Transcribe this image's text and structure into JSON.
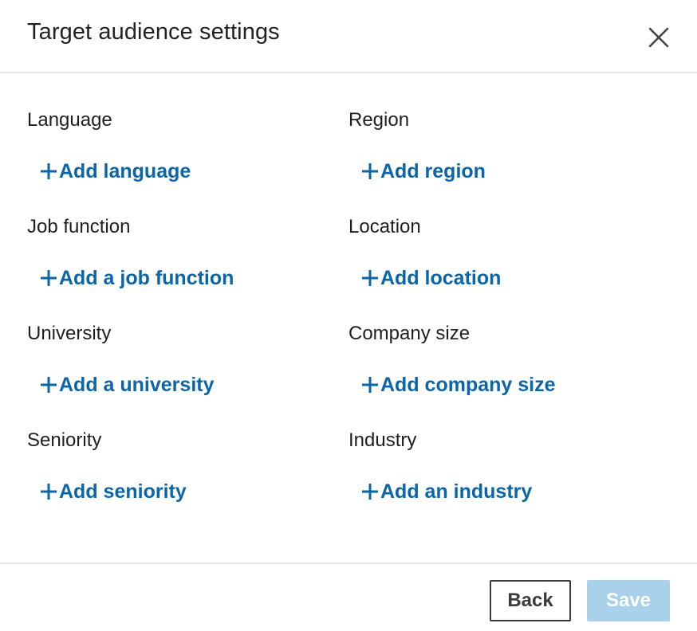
{
  "dialog": {
    "title": "Target audience settings"
  },
  "fields": {
    "language": {
      "label": "Language",
      "action": "Add language"
    },
    "region": {
      "label": "Region",
      "action": "Add region"
    },
    "job_function": {
      "label": "Job function",
      "action": "Add a job function"
    },
    "location": {
      "label": "Location",
      "action": "Add location"
    },
    "university": {
      "label": "University",
      "action": "Add a university"
    },
    "company_size": {
      "label": "Company size",
      "action": "Add company size"
    },
    "seniority": {
      "label": "Seniority",
      "action": "Add seniority"
    },
    "industry": {
      "label": "Industry",
      "action": "Add an industry"
    }
  },
  "footer": {
    "back_label": "Back",
    "save_label": "Save"
  },
  "icons": {
    "close": "close-icon",
    "add": "plus-icon"
  },
  "colors": {
    "link": "#0a66a8",
    "save_disabled_bg": "#a9d1ea",
    "divider": "#e2e6ea"
  }
}
